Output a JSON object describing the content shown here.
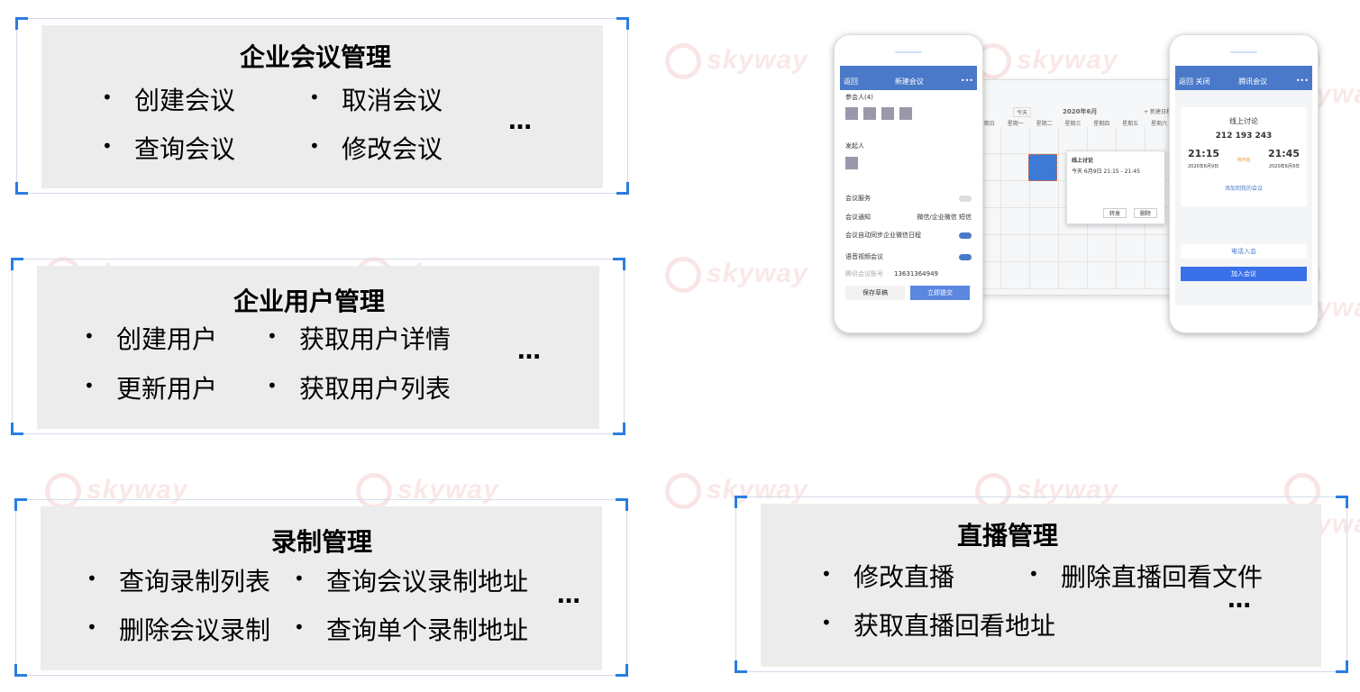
{
  "watermark": "skyway",
  "cards": [
    {
      "title": "企业会议管理",
      "items": [
        "创建会议",
        "取消会议",
        "查询会议",
        "修改会议"
      ],
      "more": "…"
    },
    {
      "title": "企业用户管理",
      "items": [
        "创建用户",
        "获取用户详情",
        "更新用户",
        "获取用户列表"
      ],
      "more": "…"
    },
    {
      "title": "录制管理",
      "items": [
        "查询录制列表",
        "查询会议录制地址",
        "删除会议录制",
        "查询单个录制地址"
      ],
      "more": "…"
    },
    {
      "title": "直播管理",
      "items": [
        "修改直播",
        "删除直播回看文件",
        "获取直播回看地址"
      ],
      "more": "…"
    }
  ],
  "left_phone": {
    "back": "返回",
    "title": "新建会议",
    "more": "•••",
    "participants": "参会人(4)",
    "initiator": "发起人",
    "service": "会议服务",
    "notify": "会议通知",
    "wechat": "微信/企业微信",
    "sms": "短信",
    "sync": "会议自动同步企业微信日程",
    "av": "语音视频会议",
    "account_label": "腾讯会议账号",
    "account": "13631364949",
    "save": "保存草稿",
    "submit": "立即提交"
  },
  "calendar": {
    "month": "2020年6月",
    "today": "今天",
    "new": "+ 新建日程",
    "weekdays": [
      "星期日",
      "星期一",
      "星期二",
      "星期三",
      "星期四",
      "星期五",
      "星期六"
    ],
    "popup_title": "线上讨论",
    "popup_time": "今天 6月9日 21:15 - 21:45",
    "forward": "转发",
    "delete": "删除"
  },
  "right_phone": {
    "back": "返回",
    "close": "关闭",
    "title": "腾讯会议",
    "more": "•••",
    "meeting": "线上讨论",
    "id": "212 193 243",
    "start": "21:15",
    "end": "21:45",
    "date": "2020年6月9日",
    "status": "待开始",
    "add": "添加到我的会议",
    "phone": "电话入会",
    "join": "加入会议"
  },
  "colors": {
    "accent": "#2a7de1",
    "panel": "#ececec",
    "app_blue": "#4a79c9"
  }
}
